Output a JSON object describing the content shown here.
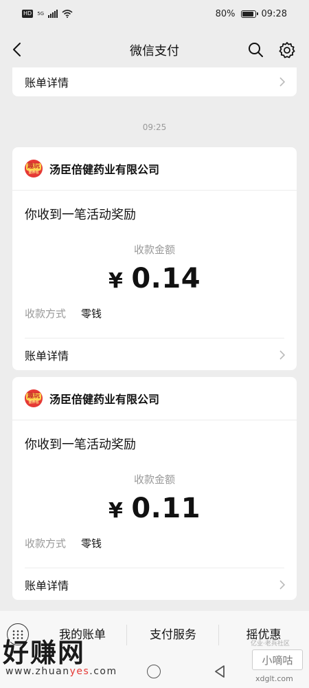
{
  "status_bar": {
    "left_badge": "HD",
    "network": "5G",
    "battery": "80%",
    "time": "09:28"
  },
  "nav": {
    "title": "微信支付",
    "back_icon": "chevron-left-icon",
    "search_icon": "search-icon",
    "settings_icon": "gear-icon"
  },
  "top_card": {
    "detail_label": "账单详情"
  },
  "time_divider": "09:25",
  "messages": [
    {
      "merchant_name": "汤臣倍健药业有限公司",
      "logo_text": "趣玩",
      "logo_subtext": "营养包",
      "title": "你收到一笔活动奖励",
      "amount_label": "收款金额",
      "currency": "¥",
      "amount": "0.14",
      "method_key": "收款方式",
      "method_value": "零钱",
      "detail_label": "账单详情"
    },
    {
      "merchant_name": "汤臣倍健药业有限公司",
      "logo_text": "趣玩",
      "logo_subtext": "营养包",
      "title": "你收到一笔活动奖励",
      "amount_label": "收款金额",
      "currency": "¥",
      "amount": "0.11",
      "method_key": "收款方式",
      "method_value": "零钱",
      "detail_label": "账单详情"
    }
  ],
  "bottom_menu": {
    "tabs": [
      "我的账单",
      "支付服务",
      "摇优惠"
    ]
  },
  "watermarks": {
    "big": "好赚网",
    "url_prefix": "www.zhuan",
    "url_highlight": "yes",
    "url_suffix": ".com",
    "box": "小嘀咕",
    "sub": "亿业·老兵社区",
    "url2": "xdglt.com"
  },
  "colors": {
    "background": "#ededed",
    "card": "#ffffff",
    "logo": "#e53935",
    "muted_text": "#999999"
  }
}
